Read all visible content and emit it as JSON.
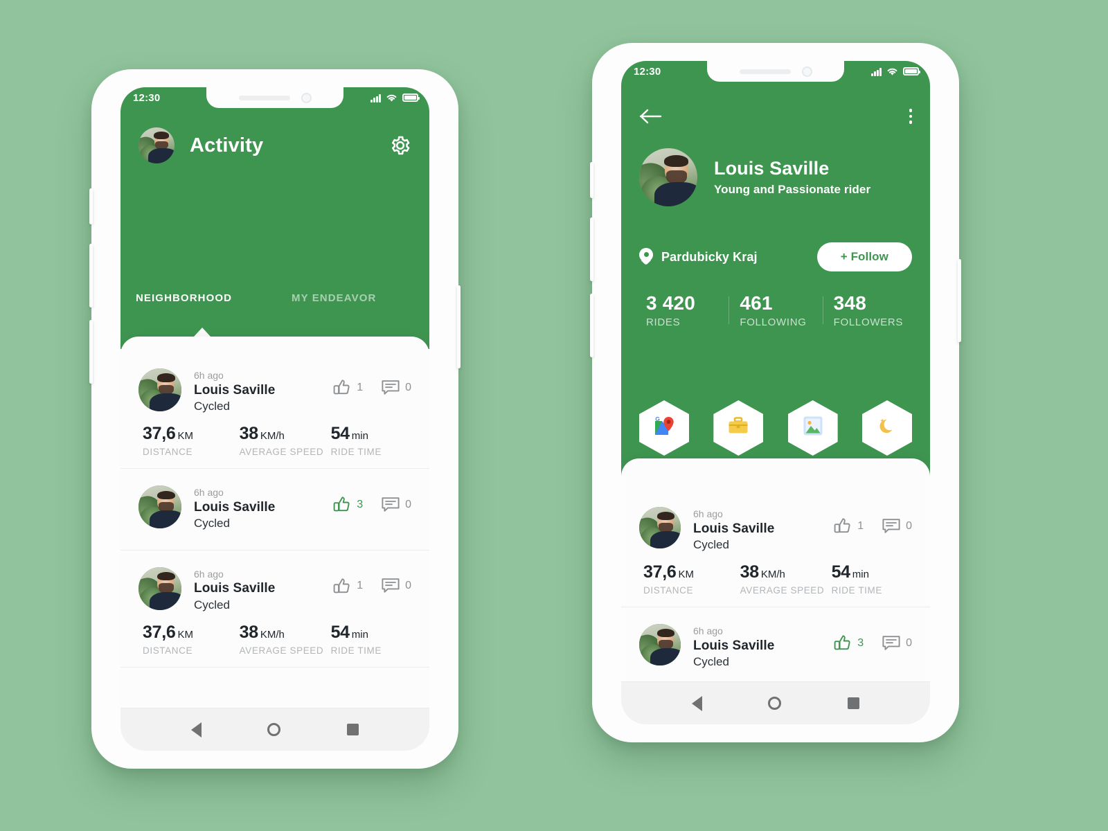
{
  "theme": {
    "page_bg": "#91c49c",
    "brand_green": "#3e9550",
    "sheet_bg": "#fcfcfc",
    "muted_text": "#b2b5b8"
  },
  "left_phone": {
    "status_bar": {
      "time": "12:30",
      "signal_icon": "signal-bars-icon",
      "wifi_icon": "wifi-icon",
      "battery_icon": "battery-full-icon"
    },
    "app_bar": {
      "avatar_icon": "user-avatar",
      "title": "Activity",
      "settings_icon": "gear-icon"
    },
    "tabs": [
      {
        "label": "NEIGHBORHOOD",
        "active": true
      },
      {
        "label": "MY ENDEAVOR",
        "active": false
      }
    ],
    "feed": [
      {
        "time": "6h ago",
        "name": "Louis Saville",
        "action": "Cycled",
        "likes": "1",
        "liked": false,
        "comments": "0",
        "stats": [
          {
            "value": "37,6",
            "unit": "KM",
            "label": "DISTANCE"
          },
          {
            "value": "38",
            "unit": "KM/h",
            "label": "AVERAGE SPEED"
          },
          {
            "value": "54",
            "unit": "min",
            "label": "RIDE TIME"
          }
        ]
      },
      {
        "time": "6h ago",
        "name": "Louis Saville",
        "action": "Cycled",
        "likes": "3",
        "liked": true,
        "comments": "0",
        "stats": []
      },
      {
        "time": "6h ago",
        "name": "Louis Saville",
        "action": "Cycled",
        "likes": "1",
        "liked": false,
        "comments": "0",
        "stats": [
          {
            "value": "37,6",
            "unit": "KM",
            "label": "DISTANCE"
          },
          {
            "value": "38",
            "unit": "KM/h",
            "label": "AVERAGE SPEED"
          },
          {
            "value": "54",
            "unit": "min",
            "label": "RIDE TIME"
          }
        ]
      }
    ],
    "android_nav": {
      "back_icon": "back-triangle-icon",
      "home_icon": "home-circle-icon",
      "recents_icon": "recents-square-icon"
    }
  },
  "right_phone": {
    "status_bar": {
      "time": "12:30",
      "signal_icon": "signal-bars-icon",
      "wifi_icon": "wifi-icon",
      "battery_icon": "battery-full-icon"
    },
    "app_bar": {
      "back_icon": "arrow-left-icon",
      "overflow_icon": "more-vertical-icon"
    },
    "profile": {
      "avatar_icon": "user-avatar",
      "name": "Louis Saville",
      "subtitle": "Young and Passionate rider",
      "location_icon": "location-pin-icon",
      "location": "Pardubicky Kraj",
      "follow_label": "+ Follow"
    },
    "stats": [
      {
        "value": "3 420",
        "label": "RIDES"
      },
      {
        "value": "461",
        "label": "FOLLOWING"
      },
      {
        "value": "348",
        "label": "FOLLOWERS"
      }
    ],
    "badges": [
      {
        "icon": "google-maps-pin-icon",
        "glyph": ""
      },
      {
        "icon": "briefcase-icon",
        "glyph": ""
      },
      {
        "icon": "picture-frame-icon",
        "glyph": ""
      },
      {
        "icon": "crescent-moon-icon",
        "glyph": "🌙"
      }
    ],
    "feed": [
      {
        "time": "6h ago",
        "name": "Louis Saville",
        "action": "Cycled",
        "likes": "1",
        "liked": false,
        "comments": "0",
        "stats": [
          {
            "value": "37,6",
            "unit": "KM",
            "label": "DISTANCE"
          },
          {
            "value": "38",
            "unit": "KM/h",
            "label": "AVERAGE SPEED"
          },
          {
            "value": "54",
            "unit": "min",
            "label": "RIDE TIME"
          }
        ]
      },
      {
        "time": "6h ago",
        "name": "Louis Saville",
        "action": "Cycled",
        "likes": "3",
        "liked": true,
        "comments": "0",
        "stats": []
      }
    ],
    "android_nav": {
      "back_icon": "back-triangle-icon",
      "home_icon": "home-circle-icon",
      "recents_icon": "recents-square-icon"
    }
  }
}
